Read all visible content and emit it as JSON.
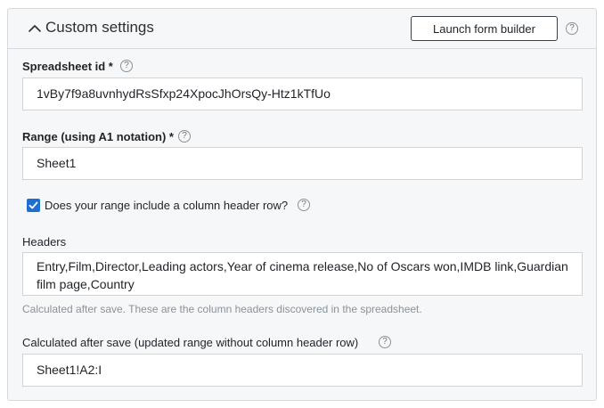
{
  "header": {
    "title": "Custom settings",
    "launch_button_label": "Launch form builder"
  },
  "fields": {
    "spreadsheet_id": {
      "label": "Spreadsheet id *",
      "value": "1vBy7f9a8uvnhydRsSfxp24XpocJhOrsQy-Htz1kTfUo"
    },
    "range": {
      "label": "Range (using A1 notation) *",
      "value": "Sheet1"
    },
    "header_row": {
      "label": "Does your range include a column header row?",
      "checked": true
    },
    "headers": {
      "label": "Headers",
      "value": "Entry,Film,Director,Leading actors,Year of cinema release,No of Oscars won,IMDB link,Guardian film page,Country",
      "hint": "Calculated after save. These are the column headers discovered in the spreadsheet."
    },
    "calculated_range": {
      "label": "Calculated after save (updated range without column header row)",
      "value": "Sheet1!A2:I"
    }
  },
  "icons": {
    "help": "?",
    "chevron": "chevron-up-icon",
    "checkmark": "checkmark-icon"
  },
  "colors": {
    "accent": "#1f6fcf",
    "panel_background": "#f6f7f8",
    "hint_text": "#8a9299"
  }
}
